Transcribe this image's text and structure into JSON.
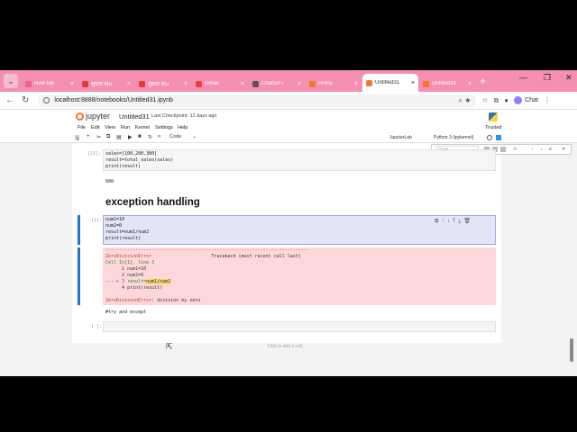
{
  "browser": {
    "tabs": [
      {
        "title": "New tab",
        "color": "#f06292"
      },
      {
        "title": "सुवारा Mu",
        "color": "#e53935"
      },
      {
        "title": "सुवारा Mu",
        "color": "#e53935"
      },
      {
        "title": "Gmail",
        "color": "#ea4335"
      },
      {
        "title": "ChatGPT",
        "color": "#555555"
      },
      {
        "title": "Home",
        "color": "#f37726"
      },
      {
        "title": "Untitled31",
        "color": "#f37726",
        "active": true
      },
      {
        "title": "Untitled32",
        "color": "#f37726"
      }
    ],
    "url": "localhost:8888/notebooks/Untitled31.ipynb",
    "chat_label": "Chat"
  },
  "jupyter": {
    "logo_text": "jupyter",
    "notebook_name": "Untitled31",
    "checkpoint": "Last Checkpoint: 12 days ago",
    "menu": [
      "File",
      "Edit",
      "View",
      "Run",
      "Kernel",
      "Settings",
      "Help"
    ],
    "trusted": "Trusted",
    "cell_type": "Code",
    "kernel_left": "JupyterLab",
    "kernel_right": "Python 3 (ipykernel)",
    "find_placeholder": "Find",
    "find_count": "-/-"
  },
  "cells": {
    "c1_prompt": "[21]:",
    "c1_lines": [
      "sales=[100,200,300]",
      "result=total_sales(sales)",
      "print(result)"
    ],
    "c1_output": "600",
    "heading": "exception handling",
    "c2_prompt": "[1]:",
    "c2_lines": [
      "num1=10",
      "num2=0",
      "result=num1/num2",
      "print(result)"
    ],
    "err_dash": "---------------------------------------------------------------------------",
    "err_name": "ZeroDivisionError",
    "err_tb": "Traceback (most recent call last)",
    "err_cell": "Cell In[1], line 3",
    "err_l1": "      1 num1=10",
    "err_l2": "      2 num2=0",
    "err_arrow": "----> 3 result=",
    "err_arrow_hl": "num1/num2",
    "err_l4": "      4 print(result)",
    "err_final_name": "ZeroDivisionError",
    "err_final_msg": ": division by zero",
    "md_text": "#try and except",
    "c3_prompt": "[ ]:",
    "add_cell": "Click to add a cell."
  }
}
